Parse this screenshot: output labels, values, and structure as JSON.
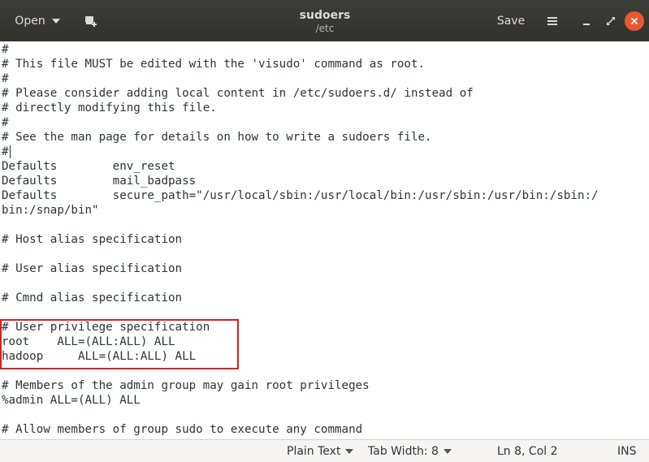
{
  "window": {
    "title": "sudoers",
    "subtitle": "/etc",
    "open_label": "Open",
    "save_label": "Save"
  },
  "document": {
    "lines": [
      "#",
      "# This file MUST be edited with the 'visudo' command as root.",
      "#",
      "# Please consider adding local content in /etc/sudoers.d/ instead of",
      "# directly modifying this file.",
      "#",
      "# See the man page for details on how to write a sudoers file.",
      "#",
      "Defaults        env_reset",
      "Defaults        mail_badpass",
      "Defaults        secure_path=\"/usr/local/sbin:/usr/local/bin:/usr/sbin:/usr/bin:/sbin:/",
      "bin:/snap/bin\"",
      "",
      "# Host alias specification",
      "",
      "# User alias specification",
      "",
      "# Cmnd alias specification",
      "",
      "# User privilege specification",
      "root    ALL=(ALL:ALL) ALL",
      "hadoop     ALL=(ALL:ALL) ALL",
      "",
      "# Members of the admin group may gain root privileges",
      "%admin ALL=(ALL) ALL",
      "",
      "# Allow members of group sudo to execute any command"
    ]
  },
  "statusbar": {
    "language": "Plain Text",
    "tab_width": "Tab Width: 8",
    "position": "Ln 8, Col 2",
    "mode": "INS"
  },
  "icons": {
    "new_document": "new-document-icon",
    "menu": "hamburger-menu-icon",
    "minimize": "minimize-icon",
    "maximize": "maximize-icon",
    "close": "close-icon"
  },
  "colors": {
    "headerbar": "#3d3d39",
    "close_button": "#e9592e",
    "highlight_border": "#dc1d23",
    "text": "#2e3436"
  }
}
